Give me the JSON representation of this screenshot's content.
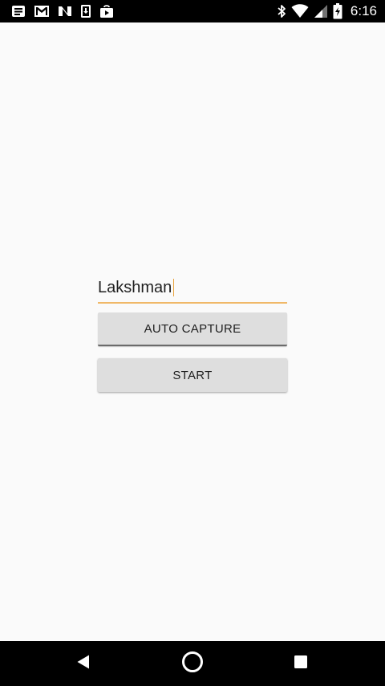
{
  "status_bar": {
    "notification_icons": [
      "notes-icon",
      "gmail-icon",
      "n-app-icon",
      "download-icon",
      "play-store-icon"
    ],
    "system_icons": [
      "bluetooth-icon",
      "wifi-icon",
      "signal-icon",
      "battery-charging-icon"
    ],
    "time": "6:16"
  },
  "form": {
    "name_value": "Lakshman",
    "auto_capture_label": "AUTO CAPTURE",
    "start_label": "START"
  },
  "colors": {
    "input_underline": "#f0b868",
    "button_background": "#dedede",
    "background": "#fafafa"
  },
  "nav_bar": {
    "icons": [
      "back-icon",
      "home-icon",
      "recent-apps-icon"
    ]
  }
}
